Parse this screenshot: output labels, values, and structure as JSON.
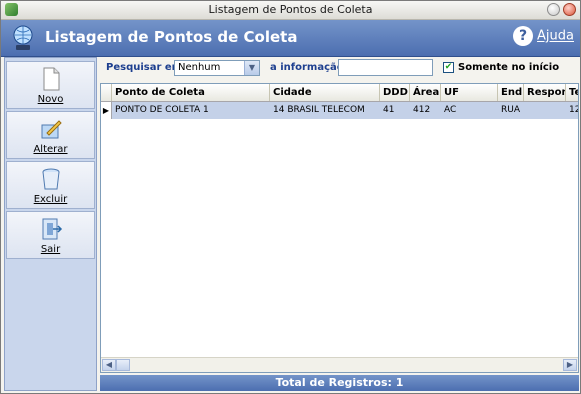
{
  "window": {
    "title": "Listagem de Pontos de Coleta"
  },
  "header": {
    "title": "Listagem de Pontos de Coleta",
    "help_label": "Ajuda",
    "help_symbol": "?"
  },
  "sidebar": {
    "items": [
      {
        "label": "Novo",
        "icon": "new-document-icon"
      },
      {
        "label": "Alterar",
        "icon": "edit-icon"
      },
      {
        "label": "Excluir",
        "icon": "trash-icon"
      },
      {
        "label": "Sair",
        "icon": "exit-door-icon"
      }
    ]
  },
  "search": {
    "label": "Pesquisar em",
    "field_value": "Nenhum",
    "info_label": "a informação",
    "info_value": "",
    "only_start_label": "Somente no início",
    "only_start_checked": true
  },
  "grid": {
    "columns": [
      "Ponto de Coleta",
      "Cidade",
      "DDD",
      "Área",
      "UF",
      "End",
      "Respon",
      "Te"
    ],
    "rows": [
      [
        "PONTO DE COLETA 1",
        "14 BRASIL TELECOM",
        "41",
        "412",
        "AC",
        "RUA",
        "",
        "12"
      ]
    ]
  },
  "footer": {
    "total_label": "Total de Registros: 1"
  },
  "colors": {
    "header_blue": "#5b7cbc",
    "selection": "#c4d1e8"
  }
}
